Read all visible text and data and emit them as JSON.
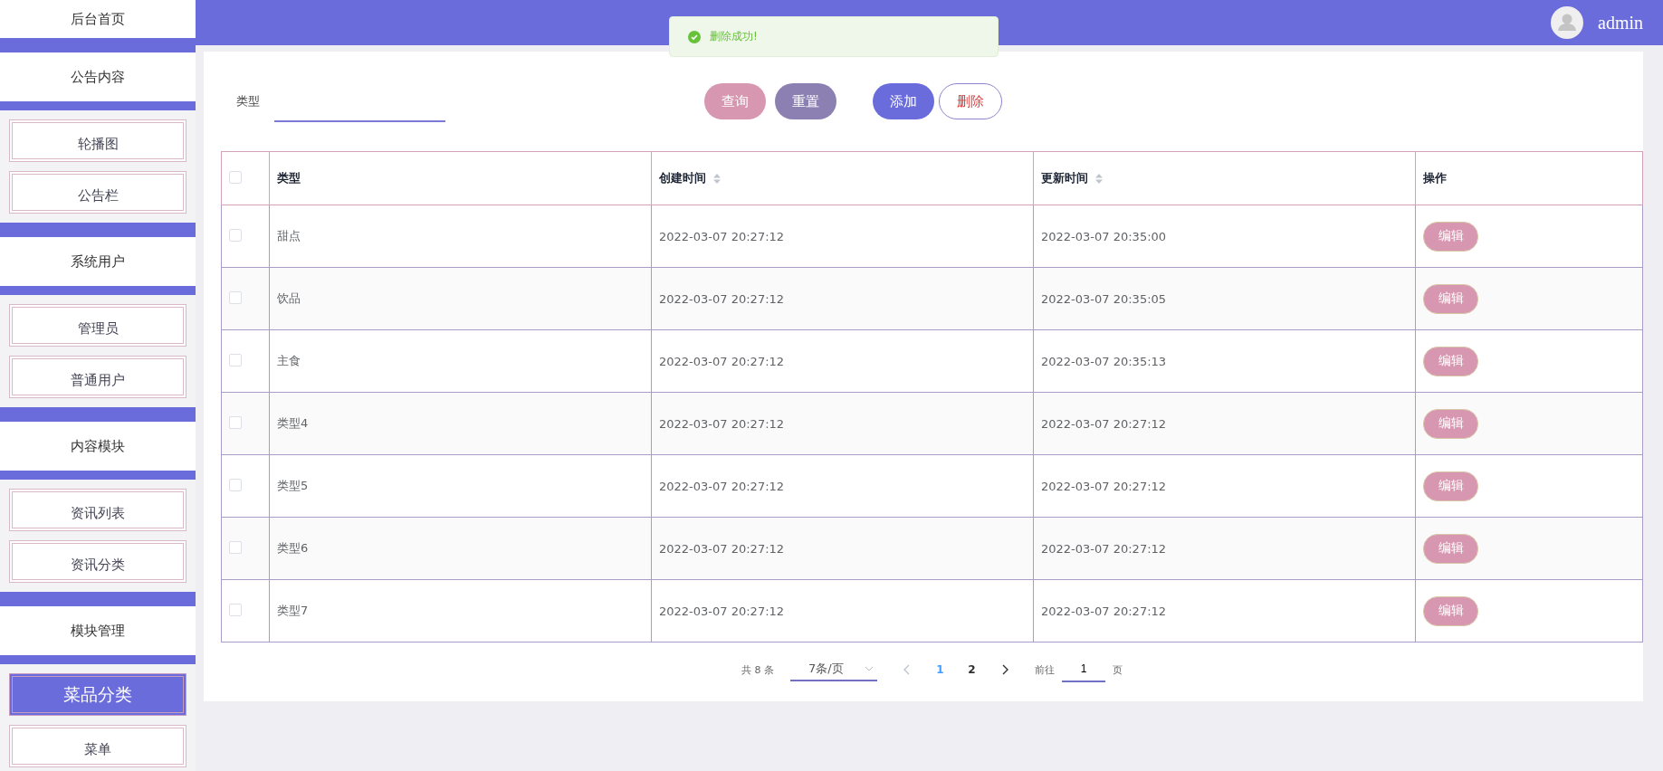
{
  "sidebar": {
    "home": "后台首页",
    "groups": [
      {
        "title": "公告内容",
        "items": [
          {
            "label": "轮播图",
            "selected": false
          },
          {
            "label": "公告栏",
            "selected": false
          }
        ]
      },
      {
        "title": "系统用户",
        "items": [
          {
            "label": "管理员",
            "selected": false
          },
          {
            "label": "普通用户",
            "selected": false
          }
        ]
      },
      {
        "title": "内容模块",
        "items": [
          {
            "label": "资讯列表",
            "selected": false
          },
          {
            "label": "资讯分类",
            "selected": false
          }
        ]
      },
      {
        "title": "模块管理",
        "items": [
          {
            "label": "菜品分类",
            "selected": true
          },
          {
            "label": "菜单",
            "selected": false
          }
        ]
      }
    ]
  },
  "header": {
    "user": "admin"
  },
  "toast": {
    "message": "删除成功!"
  },
  "search": {
    "label": "类型"
  },
  "buttons": [
    {
      "label": "查询",
      "kind": "query"
    },
    {
      "label": "重置",
      "kind": "reset"
    },
    {
      "label": "添加",
      "kind": "add"
    },
    {
      "label": "删除",
      "kind": "delete"
    }
  ],
  "table": {
    "select_all": {
      "checked": false
    },
    "columns": [
      {
        "label": "类型",
        "sortable": false
      },
      {
        "label": "创建时间",
        "sortable": true
      },
      {
        "label": "更新时间",
        "sortable": true
      },
      {
        "label": "操作",
        "sortable": false
      }
    ],
    "rows": [
      {
        "checked": false,
        "cells": [
          "甜点",
          "2022-03-07 20:27:12",
          "2022-03-07 20:35:00"
        ],
        "action": "编辑"
      },
      {
        "checked": false,
        "cells": [
          "饮品",
          "2022-03-07 20:27:12",
          "2022-03-07 20:35:05"
        ],
        "action": "编辑"
      },
      {
        "checked": false,
        "cells": [
          "主食",
          "2022-03-07 20:27:12",
          "2022-03-07 20:35:13"
        ],
        "action": "编辑"
      },
      {
        "checked": false,
        "cells": [
          "类型4",
          "2022-03-07 20:27:12",
          "2022-03-07 20:27:12"
        ],
        "action": "编辑"
      },
      {
        "checked": false,
        "cells": [
          "类型5",
          "2022-03-07 20:27:12",
          "2022-03-07 20:27:12"
        ],
        "action": "编辑"
      },
      {
        "checked": false,
        "cells": [
          "类型6",
          "2022-03-07 20:27:12",
          "2022-03-07 20:27:12"
        ],
        "action": "编辑"
      },
      {
        "checked": false,
        "cells": [
          "类型7",
          "2022-03-07 20:27:12",
          "2022-03-07 20:27:12"
        ],
        "action": "编辑"
      }
    ]
  },
  "pagination": {
    "total": "共 8 条",
    "page_size": "7条/页",
    "pages": [
      {
        "label": "1",
        "selected": true
      },
      {
        "label": "2",
        "selected": false
      }
    ],
    "goto_label": "前往",
    "goto_value": "1",
    "goto_suffix": "页"
  }
}
